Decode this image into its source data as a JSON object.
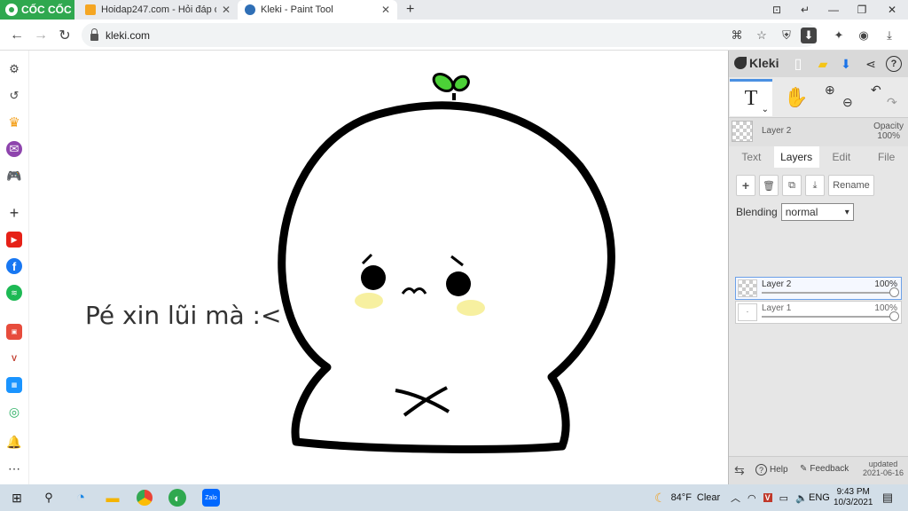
{
  "browser": {
    "brand": "CỐC CỐC",
    "tabs": [
      {
        "title": "Hoidap247.com - Hỏi đáp or",
        "close": "✕"
      },
      {
        "title": "Kleki - Paint Tool",
        "close": "✕"
      }
    ],
    "new_tab": "+",
    "url": "kleki.com"
  },
  "canvas": {
    "caption": "Pé xin lũi mà :<"
  },
  "kleki": {
    "brand": "Kleki",
    "tool_text_glyph": "T",
    "current_layer": "Layer 2",
    "opacity_label": "Opacity",
    "opacity_value": "100%",
    "tabs": [
      "Text",
      "Layers",
      "Edit",
      "File"
    ],
    "active_tab": "Layers",
    "rename_label": "Rename",
    "blending_label": "Blending",
    "blending_value": "normal",
    "layers": [
      {
        "name": "Layer 2",
        "opacity": "100%",
        "selected": true
      },
      {
        "name": "Layer 1",
        "opacity": "100%",
        "selected": false
      }
    ],
    "footer": {
      "help": "Help",
      "feedback": "Feedback",
      "updated_label": "updated",
      "updated_date": "2021-06-16"
    }
  },
  "taskbar": {
    "weather_temp": "84°F",
    "weather_desc": "Clear",
    "language": "ENG",
    "time": "9:43 PM",
    "date": "10/3/2021",
    "zalo_label": "Zalo"
  },
  "colors": {
    "coccoc_green": "#2fa84f",
    "kleki_accent": "#4a90e2",
    "sprout_green": "#4cd137",
    "cheek_yellow": "#f7f0a0"
  }
}
